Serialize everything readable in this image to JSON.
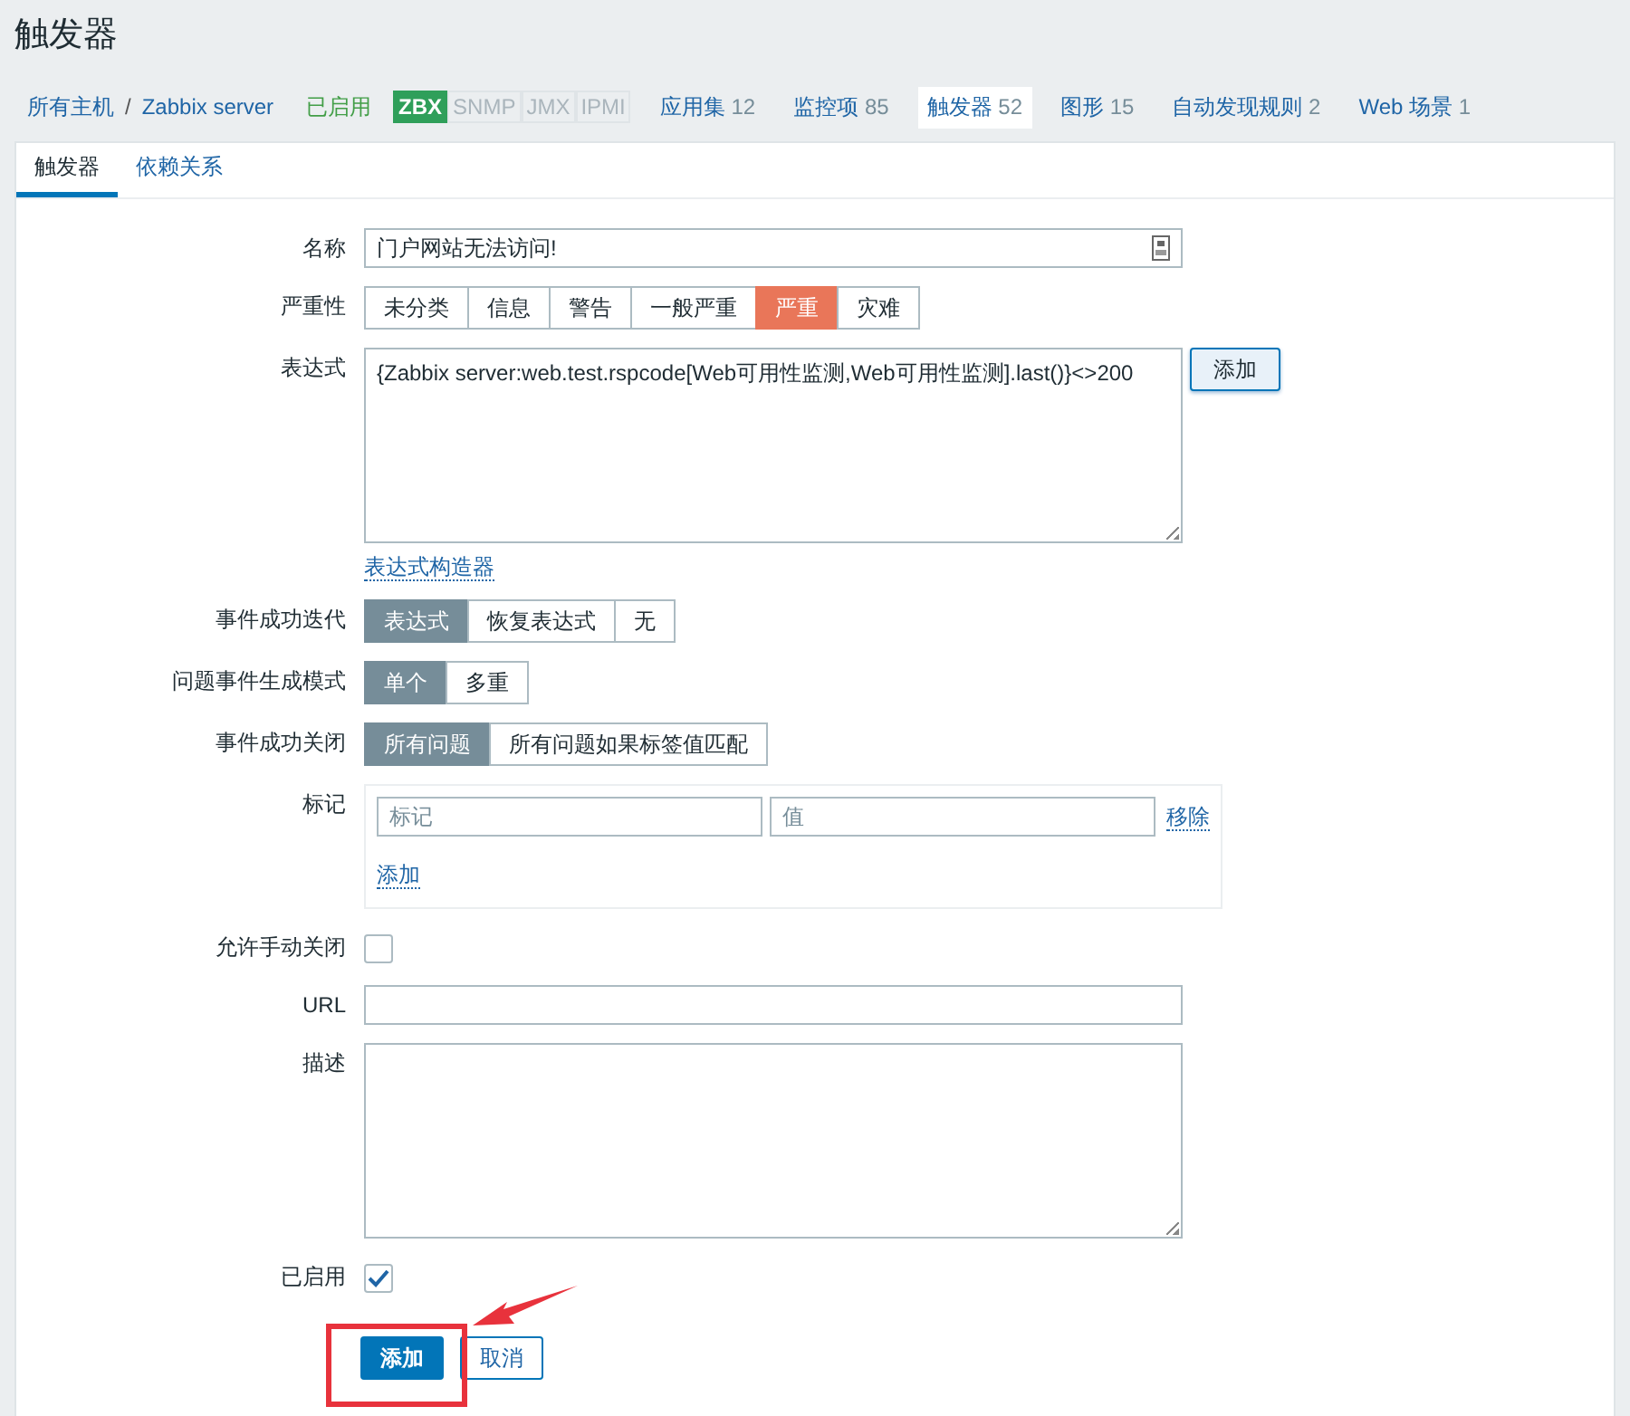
{
  "page_title": "触发器",
  "nav": {
    "breadcrumb": [
      {
        "label": "所有主机"
      },
      {
        "label": "Zabbix server"
      }
    ],
    "separator": "/",
    "status": "已启用",
    "availability": [
      {
        "label": "ZBX",
        "on": true
      },
      {
        "label": "SNMP",
        "on": false
      },
      {
        "label": "JMX",
        "on": false
      },
      {
        "label": "IPMI",
        "on": false
      }
    ],
    "links": [
      {
        "label": "应用集",
        "count": "12",
        "selected": false
      },
      {
        "label": "监控项",
        "count": "85",
        "selected": false
      },
      {
        "label": "触发器",
        "count": "52",
        "selected": true
      },
      {
        "label": "图形",
        "count": "15",
        "selected": false
      },
      {
        "label": "自动发现规则",
        "count": "2",
        "selected": false
      },
      {
        "label": "Web 场景",
        "count": "1",
        "selected": false
      }
    ]
  },
  "tabs": [
    {
      "label": "触发器",
      "selected": true
    },
    {
      "label": "依赖关系",
      "selected": false
    }
  ],
  "form": {
    "name": {
      "label": "名称",
      "value": "门户网站无法访问!"
    },
    "severity": {
      "label": "严重性",
      "kind": "severity",
      "options": [
        {
          "label": "未分类",
          "selected": false
        },
        {
          "label": "信息",
          "selected": false
        },
        {
          "label": "警告",
          "selected": false
        },
        {
          "label": "一般严重",
          "selected": false
        },
        {
          "label": "严重",
          "selected": true
        },
        {
          "label": "灾难",
          "selected": false
        }
      ]
    },
    "expression": {
      "label": "表达式",
      "value": "{Zabbix server:web.test.rspcode[Web可用性监测,Web可用性监测].last()}<>200",
      "button": "添加",
      "link": "表达式构造器"
    },
    "recovery": {
      "label": "事件成功迭代",
      "kind": "radio",
      "options": [
        {
          "label": "表达式",
          "selected": true
        },
        {
          "label": "恢复表达式",
          "selected": false
        },
        {
          "label": "无",
          "selected": false
        }
      ]
    },
    "problem_mode": {
      "label": "问题事件生成模式",
      "kind": "radio",
      "options": [
        {
          "label": "单个",
          "selected": true
        },
        {
          "label": "多重",
          "selected": false
        }
      ]
    },
    "ok_close": {
      "label": "事件成功关闭",
      "kind": "radio",
      "options": [
        {
          "label": "所有问题",
          "selected": true
        },
        {
          "label": "所有问题如果标签值匹配",
          "selected": false
        }
      ]
    },
    "tags": {
      "label": "标记",
      "tag_placeholder": "标记",
      "value_placeholder": "值",
      "remove": "移除",
      "add": "添加"
    },
    "manual_close": {
      "label": "允许手动关闭",
      "checked": false
    },
    "url": {
      "label": "URL"
    },
    "description": {
      "label": "描述"
    },
    "enabled": {
      "label": "已启用",
      "checked": true
    }
  },
  "buttons": [
    {
      "label": "添加",
      "kind": "primary"
    },
    {
      "label": "取消",
      "kind": "secondary"
    }
  ]
}
